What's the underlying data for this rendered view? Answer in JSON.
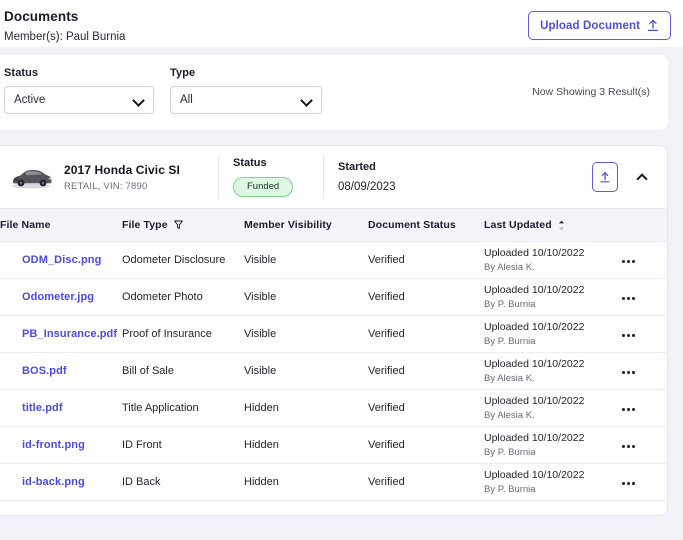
{
  "header": {
    "title": "Documents",
    "subtitle": "Member(s): Paul Burnia",
    "upload_button_label": "Upload Document",
    "upload_icon": "upload-arrow-icon"
  },
  "filters": {
    "status": {
      "label": "Status",
      "value": "Active",
      "chevron_icon": "chevron-down-icon"
    },
    "type": {
      "label": "Type",
      "value": "All",
      "chevron_icon": "chevron-down-icon"
    },
    "results_text": "Now Showing 3 Result(s)"
  },
  "vehicle": {
    "thumbnail_icon": "car-photo",
    "name": "2017 Honda Civic SI",
    "details": "RETAIL, VIN: 7890",
    "status_label": "Status",
    "status_value": "Funded",
    "status_color": "#ddf7e3",
    "status_border_color": "#7fd694",
    "started_label": "Started",
    "started_value": "08/09/2023",
    "upload_icon": "upload-arrow-icon",
    "collapse_icon": "chevron-up-icon"
  },
  "table": {
    "columns": [
      {
        "key": "file_name",
        "label": "File Name",
        "icon": null
      },
      {
        "key": "file_type",
        "label": "File Type",
        "icon": "filter-funnel-icon"
      },
      {
        "key": "member_visibility",
        "label": "Member Visibility",
        "icon": null
      },
      {
        "key": "document_status",
        "label": "Document Status",
        "icon": null
      },
      {
        "key": "last_updated",
        "label": "Last Updated",
        "icon": "sort-ascending-icon"
      },
      {
        "key": "actions",
        "label": "",
        "icon": null
      }
    ],
    "rows": [
      {
        "file_name": "ODM_Disc.png",
        "file_type": "Odometer Disclosure",
        "member_visibility": "Visible",
        "document_status": "Verified",
        "updated_main": "Uploaded 10/10/2022",
        "updated_sub": "By Alesia K.",
        "menu_icon": "kebab-menu-icon"
      },
      {
        "file_name": "Odometer.jpg",
        "file_type": "Odometer Photo",
        "member_visibility": "Visible",
        "document_status": "Verified",
        "updated_main": "Uploaded 10/10/2022",
        "updated_sub": "By P. Burnia",
        "menu_icon": "kebab-menu-icon"
      },
      {
        "file_name": "PB_Insurance.pdf",
        "file_type": "Proof of Insurance",
        "member_visibility": "Visible",
        "document_status": "Verified",
        "updated_main": "Uploaded 10/10/2022",
        "updated_sub": "By P. Burnia",
        "menu_icon": "kebab-menu-icon"
      },
      {
        "file_name": "BOS.pdf",
        "file_type": "Bill of Sale",
        "member_visibility": "Visible",
        "document_status": "Verified",
        "updated_main": "Uploaded 10/10/2022",
        "updated_sub": "By Alesia K.",
        "menu_icon": "kebab-menu-icon"
      },
      {
        "file_name": "title.pdf",
        "file_type": "Title Application",
        "member_visibility": "Hidden",
        "document_status": "Verified",
        "updated_main": "Uploaded 10/10/2022",
        "updated_sub": "By Alesia K.",
        "menu_icon": "kebab-menu-icon"
      },
      {
        "file_name": "id-front.png",
        "file_type": "ID Front",
        "member_visibility": "Hidden",
        "document_status": "Verified",
        "updated_main": "Uploaded 10/10/2022",
        "updated_sub": "By P. Burnia",
        "menu_icon": "kebab-menu-icon"
      },
      {
        "file_name": "id-back.png",
        "file_type": "ID Back",
        "member_visibility": "Hidden",
        "document_status": "Verified",
        "updated_main": "Uploaded 10/10/2022",
        "updated_sub": "By P. Burnia",
        "menu_icon": "kebab-menu-icon"
      }
    ]
  },
  "colors": {
    "accent": "#4a4ae4",
    "page_background": "#f1f1f8",
    "card_background": "#ffffff",
    "table_header_background": "#f4f4fb",
    "link": "#4a4ae4"
  }
}
